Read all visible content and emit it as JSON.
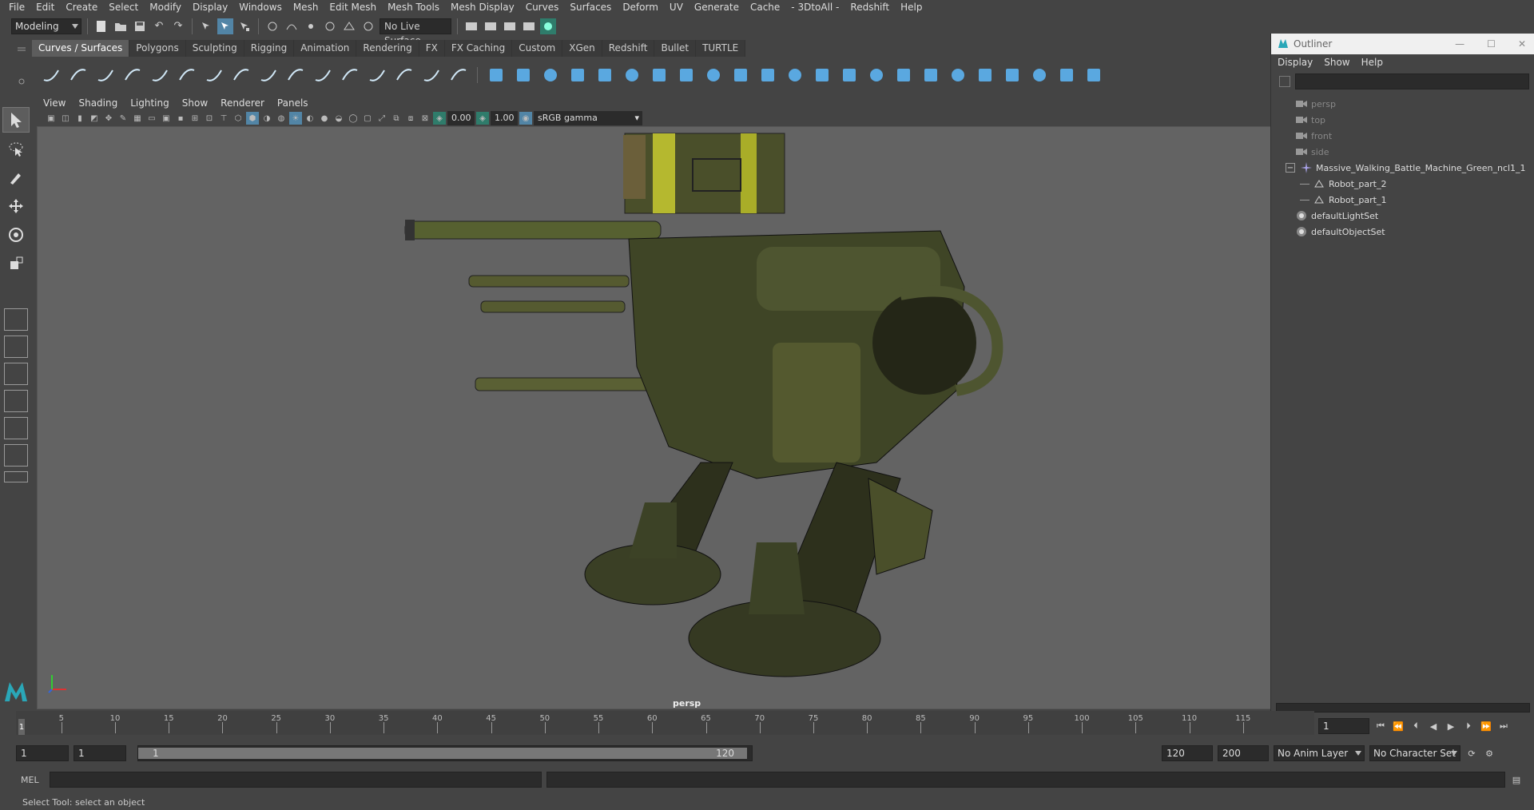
{
  "menubar": {
    "items": [
      "File",
      "Edit",
      "Create",
      "Select",
      "Modify",
      "Display",
      "Windows",
      "Mesh",
      "Edit Mesh",
      "Mesh Tools",
      "Mesh Display",
      "Curves",
      "Surfaces",
      "Deform",
      "UV",
      "Generate",
      "Cache",
      "- 3DtoAll -",
      "Redshift",
      "Help"
    ]
  },
  "statusline": {
    "menuset": "Modeling",
    "live_surface": "No Live Surface"
  },
  "shelf": {
    "tabs": [
      "Curves / Surfaces",
      "Polygons",
      "Sculpting",
      "Rigging",
      "Animation",
      "Rendering",
      "FX",
      "FX Caching",
      "Custom",
      "XGen",
      "Redshift",
      "Bullet",
      "TURTLE"
    ],
    "active_tab": "Curves / Surfaces"
  },
  "viewport": {
    "menu": [
      "View",
      "Shading",
      "Lighting",
      "Show",
      "Renderer",
      "Panels"
    ],
    "exposure": "0.00",
    "gamma": "1.00",
    "color_space": "sRGB gamma",
    "camera_label": "persp"
  },
  "outliner": {
    "title": "Outliner",
    "menu": [
      "Display",
      "Show",
      "Help"
    ],
    "items": [
      {
        "label": "persp",
        "type": "camera",
        "dim": true
      },
      {
        "label": "top",
        "type": "camera",
        "dim": true
      },
      {
        "label": "front",
        "type": "camera",
        "dim": true
      },
      {
        "label": "side",
        "type": "camera",
        "dim": true
      },
      {
        "label": "Massive_Walking_Battle_Machine_Green_ncl1_1",
        "type": "group",
        "expanded": true
      },
      {
        "label": "Robot_part_2",
        "type": "mesh",
        "child": true
      },
      {
        "label": "Robot_part_1",
        "type": "mesh",
        "child": true
      },
      {
        "label": "defaultLightSet",
        "type": "set"
      },
      {
        "label": "defaultObjectSet",
        "type": "set"
      }
    ]
  },
  "timeline": {
    "ticks": [
      "5",
      "10",
      "15",
      "20",
      "25",
      "30",
      "35",
      "40",
      "45",
      "50",
      "55",
      "60",
      "65",
      "70",
      "75",
      "80",
      "85",
      "90",
      "95",
      "100",
      "105",
      "110",
      "115"
    ],
    "current_frame": "1",
    "current_frame_field": "1"
  },
  "range": {
    "start": "1",
    "playback_start": "1",
    "slider_start": "1",
    "slider_end": "120",
    "playback_end": "120",
    "end": "200",
    "anim_layer": "No Anim Layer",
    "character_set": "No Character Set"
  },
  "cmdline": {
    "label": "MEL"
  },
  "helpline": {
    "text": "Select Tool: select an object"
  },
  "colors": {
    "accent": "#5285a6",
    "viewport_bg": "#636363",
    "panel_bg": "#444444",
    "field_bg": "#2b2b2b"
  }
}
